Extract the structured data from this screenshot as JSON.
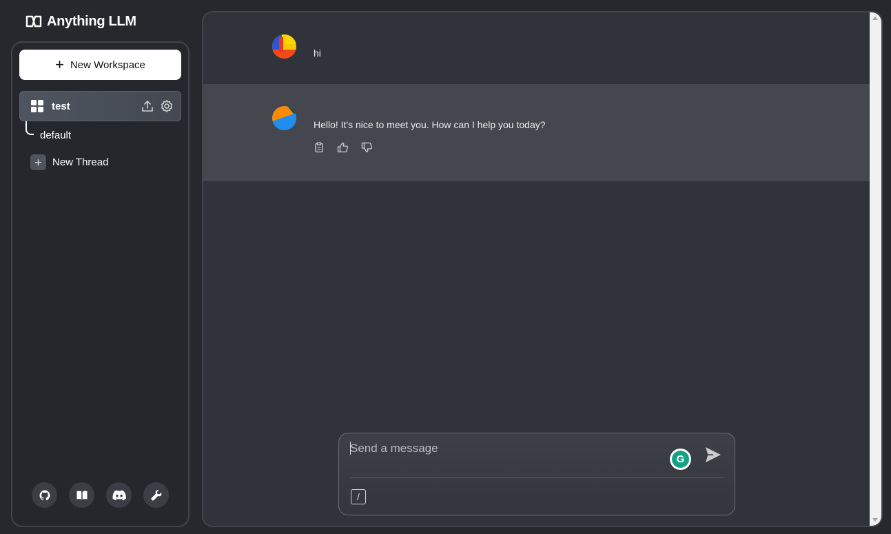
{
  "brand": {
    "name": "Anything LLM"
  },
  "sidebar": {
    "new_workspace_label": "New Workspace",
    "workspace": {
      "name": "test"
    },
    "threads": [
      {
        "label": "default"
      }
    ],
    "new_thread_label": "New Thread",
    "footer_icons": [
      "github-icon",
      "docs-book-icon",
      "discord-icon",
      "settings-wrench-icon"
    ]
  },
  "chat": {
    "messages": [
      {
        "role": "user",
        "text": "hi"
      },
      {
        "role": "assistant",
        "text": "Hello! It's nice to meet you. How can I help you today?"
      }
    ]
  },
  "composer": {
    "placeholder": "Send a message",
    "value": "",
    "slash_label": "/"
  },
  "colors": {
    "background": "#26282d",
    "main_panel": "#30333a",
    "assistant_row": "#44474e",
    "grammarly": "#15a185"
  }
}
